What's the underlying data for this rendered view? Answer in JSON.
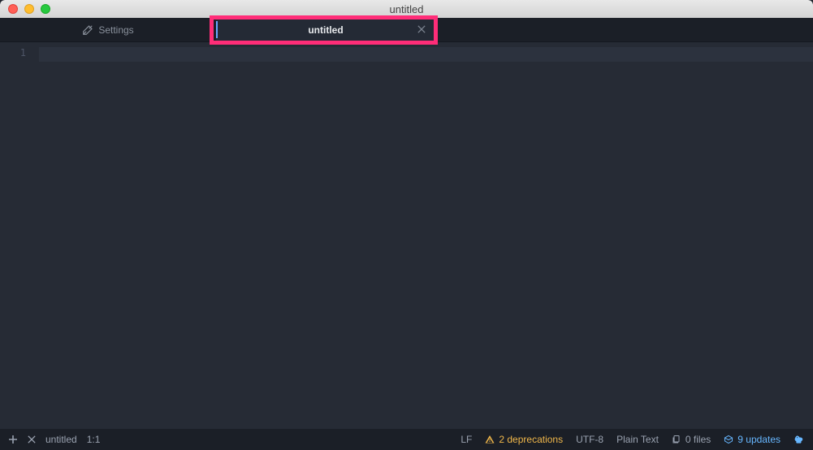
{
  "window": {
    "title": "untitled"
  },
  "tabs": [
    {
      "label": "Settings",
      "active": false,
      "icon": "settings"
    },
    {
      "label": "untitled",
      "active": true
    }
  ],
  "editor": {
    "gutter_start": "1",
    "content": ""
  },
  "statusbar": {
    "left": {
      "filename": "untitled",
      "cursor": "1:1"
    },
    "right": {
      "line_ending": "LF",
      "deprecations": "2 deprecations",
      "encoding": "UTF-8",
      "grammar": "Plain Text",
      "files": "0 files",
      "updates": "9 updates"
    }
  },
  "highlight": {
    "target_tab_index": 1
  },
  "colors": {
    "accent_highlight": "#ff2d78",
    "accent_blue": "#67b7ff",
    "warn": "#f0b74a",
    "bg": "#262b35"
  }
}
